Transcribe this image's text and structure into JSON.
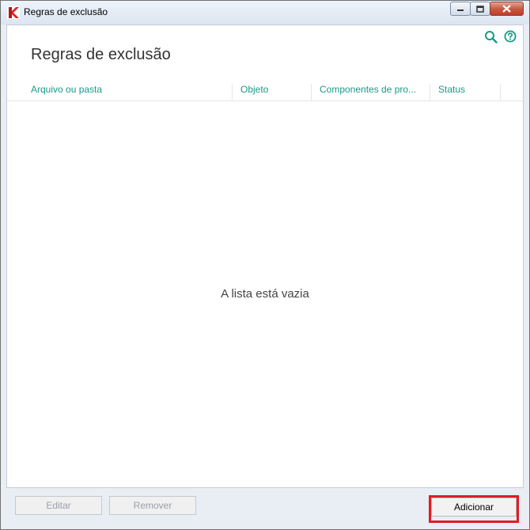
{
  "window": {
    "title": "Regras de exclusão"
  },
  "page": {
    "title": "Regras de exclusão"
  },
  "table": {
    "columns": [
      "Arquivo ou pasta",
      "Objeto",
      "Componentes de pro...",
      "Status"
    ],
    "empty_message": "A lista está vazia"
  },
  "buttons": {
    "edit": "Editar",
    "remove": "Remover",
    "add": "Adicionar"
  },
  "colors": {
    "accent": "#1a9a87",
    "highlight": "#e01b24"
  },
  "icons": [
    "app-logo-icon",
    "minimize-icon",
    "restore-icon",
    "close-icon",
    "search-icon",
    "help-icon"
  ]
}
